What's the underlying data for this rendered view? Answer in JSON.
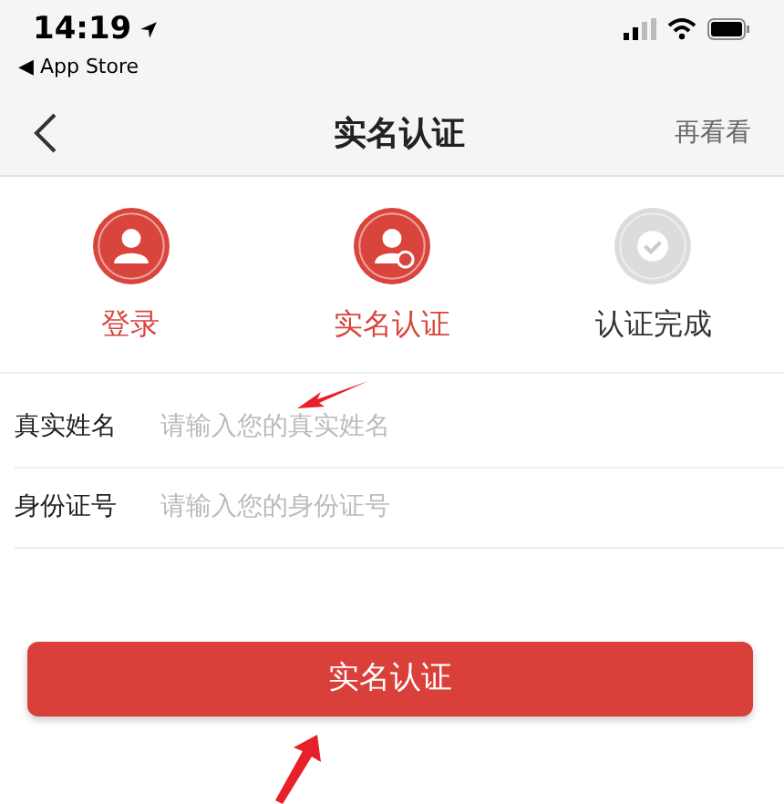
{
  "status_bar": {
    "time": "14:19",
    "back_app": "◀ App Store"
  },
  "nav": {
    "title": "实名认证",
    "action": "再看看"
  },
  "steps": [
    {
      "label": "登录",
      "active": true,
      "kind": "login"
    },
    {
      "label": "实名认证",
      "active": true,
      "kind": "verify"
    },
    {
      "label": "认证完成",
      "active": false,
      "kind": "complete"
    }
  ],
  "fields": [
    {
      "label": "真实姓名",
      "placeholder": "请输入您的真实姓名"
    },
    {
      "label": "身份证号",
      "placeholder": "请输入您的身份证号"
    }
  ],
  "submit": "实名认证"
}
